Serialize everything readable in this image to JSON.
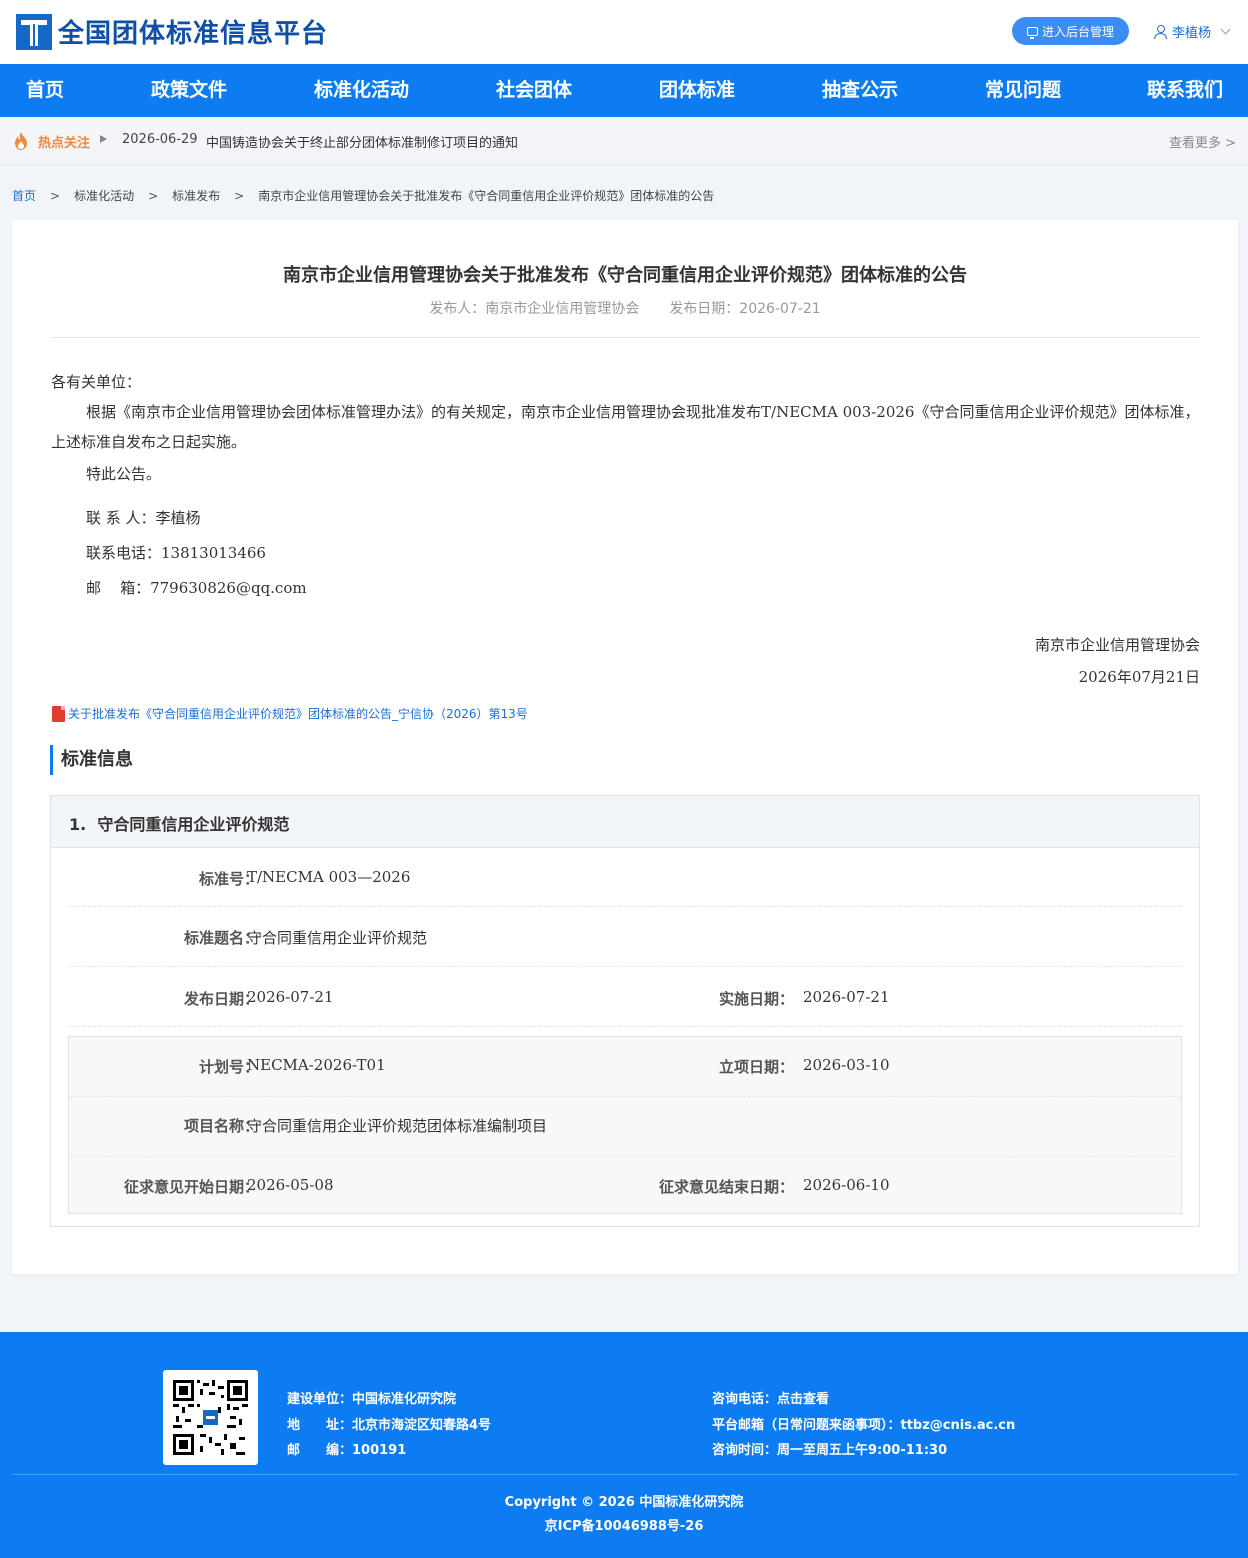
{
  "header": {
    "site_title": "全国团体标准信息平台",
    "admin_button": "进入后台管理",
    "user_name": "李植杨"
  },
  "nav": {
    "items": [
      "首页",
      "政策文件",
      "标准化活动",
      "社会团体",
      "团体标准",
      "抽查公示",
      "常见问题",
      "联系我们"
    ]
  },
  "hotbar": {
    "label": "热点关注",
    "date": "2026-06-29",
    "title": "中国铸造协会关于终止部分团体标准制修订项目的通知",
    "more": "查看更多 >"
  },
  "breadcrumb": {
    "items": [
      "首页",
      "标准化活动",
      "标准发布",
      "南京市企业信用管理协会关于批准发布《守合同重信用企业评价规范》团体标准的公告"
    ],
    "separator": ">"
  },
  "article": {
    "title": "南京市企业信用管理协会关于批准发布《守合同重信用企业评价规范》团体标准的公告",
    "publisher": "发布人：南京市企业信用管理协会",
    "publish_date": "发布日期：2026-07-21",
    "salutation": "各有关单位：",
    "paragraph": "根据《南京市企业信用管理协会团体标准管理办法》的有关规定，南京市企业信用管理协会现批准发布T/NECMA  003-2026《守合同重信用企业评价规范》团体标准，上述标准自发布之日起实施。",
    "notice": "特此公告。",
    "contact_person": "联 系 人：李植杨",
    "contact_phone": "联系电话：13813013466",
    "contact_email": "邮    箱：779630826@qq.com",
    "signature_org": "南京市企业信用管理协会",
    "signature_date": "2026年07月21日",
    "attachment": "关于批准发布《守合同重信用企业评价规范》团体标准的公告_宁信协（2026）第13号"
  },
  "standard_info": {
    "section_title": "标准信息",
    "item_title": "1.  守合同重信用企业评价规范",
    "labels": {
      "std_no": "标准号：",
      "std_name": "标准题名：",
      "pub_date": "发布日期：",
      "impl_date": "实施日期：",
      "plan_no": "计划号：",
      "approve_date": "立项日期：",
      "project_name": "项目名称：",
      "comment_start": "征求意见开始日期：",
      "comment_end": "征求意见结束日期："
    },
    "values": {
      "std_no": "T/NECMA 003—2026",
      "std_name": "守合同重信用企业评价规范",
      "pub_date": "2026-07-21",
      "impl_date": "2026-07-21",
      "plan_no": "NECMA-2026-T01",
      "approve_date": "2026-03-10",
      "project_name": "守合同重信用企业评价规范团体标准编制项目",
      "comment_start": "2026-05-08",
      "comment_end": "2026-06-10"
    }
  },
  "footer": {
    "builder": "建设单位：中国标准化研究院",
    "address": "地　　址：北京市海淀区知春路4号",
    "postcode": "邮　　编：100191",
    "phone": "咨询电话：点击查看",
    "email": "平台邮箱（日常问题来函事项）：ttbz@cnis.ac.cn",
    "hours": "咨询时间：周一至周五上午9:00-11:30",
    "copyright": "Copyright © 2026 中国标准化研究院",
    "icp": "京ICP备10046988号-26"
  },
  "colors": {
    "brand_blue": "#0d7cf2",
    "link_blue": "#1a6fd6",
    "hot_orange": "#f08a3e"
  }
}
